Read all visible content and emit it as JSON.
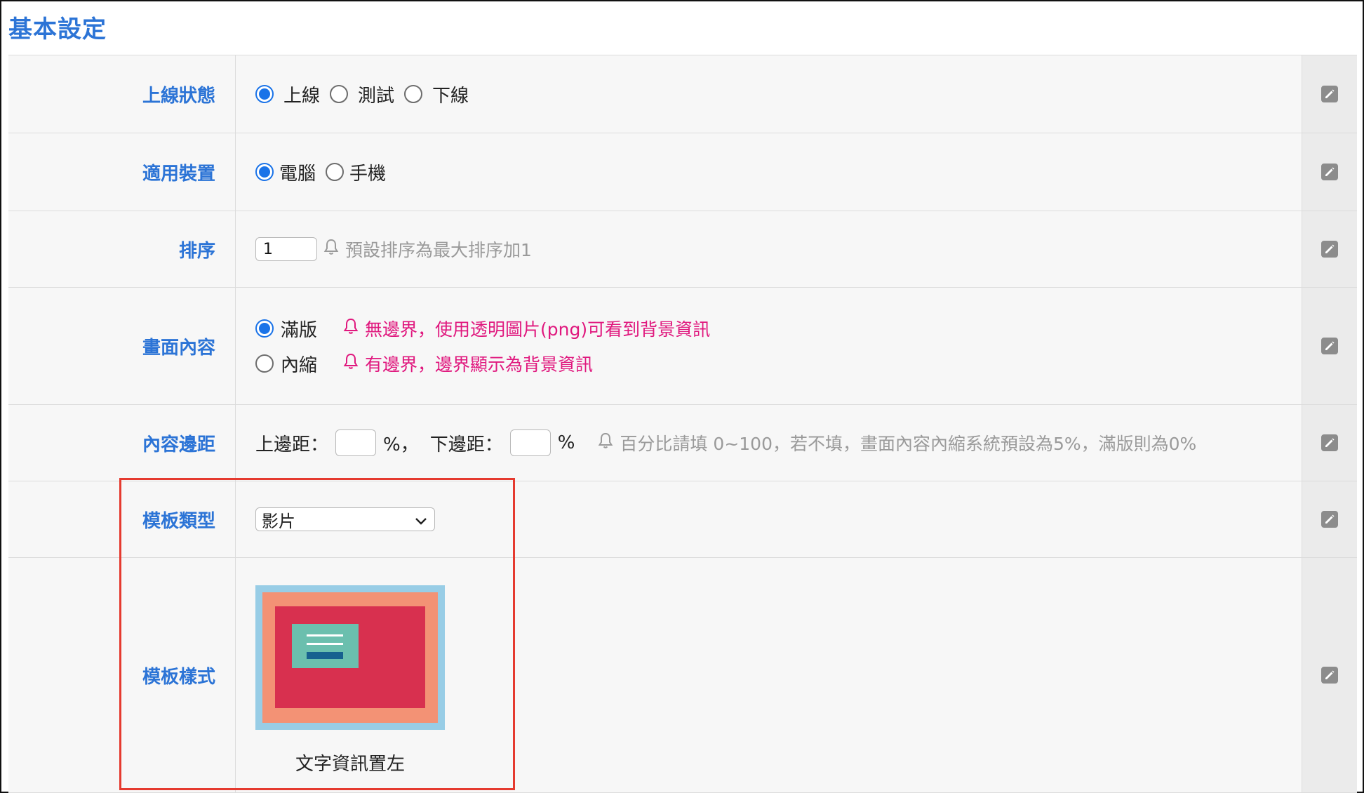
{
  "section_title": "基本設定",
  "rows": {
    "online_status": {
      "label": "上線狀態",
      "options": [
        "上線",
        "測試",
        "下線"
      ],
      "selected": "上線"
    },
    "device": {
      "label": "適用裝置",
      "options": [
        "電腦",
        "手機"
      ],
      "selected": "電腦"
    },
    "sort": {
      "label": "排序",
      "value": "1",
      "hint": "預設排序為最大排序加1"
    },
    "screen_content": {
      "label": "畫面內容",
      "options": [
        {
          "label": "滿版",
          "hint": "無邊界，使用透明圖片(png)可看到背景資訊"
        },
        {
          "label": "內縮",
          "hint": "有邊界，邊界顯示為背景資訊"
        }
      ],
      "selected": "滿版"
    },
    "margin": {
      "label": "內容邊距",
      "top_label": "上邊距：",
      "top_unit": "%，",
      "bottom_label": "下邊距：",
      "bottom_unit": "%",
      "top_value": "",
      "bottom_value": "",
      "hint": "百分比請填 0~100，若不填，畫面內容內縮系統預設為5%，滿版則為0%"
    },
    "template_type": {
      "label": "模板類型",
      "selected": "影片"
    },
    "template_style": {
      "label": "模板樣式",
      "caption": "文字資訊置左"
    }
  },
  "colors": {
    "label_blue": "#2c74d6",
    "radio_blue": "#1a73e8",
    "hint_pink": "#e0187e",
    "hint_grey": "#9a9a9a",
    "highlight_red": "#e53a2f"
  },
  "icons": {
    "edit": "pencil-edit-icon",
    "bell": "bell-icon",
    "dropdown": "chevron-down-icon"
  }
}
